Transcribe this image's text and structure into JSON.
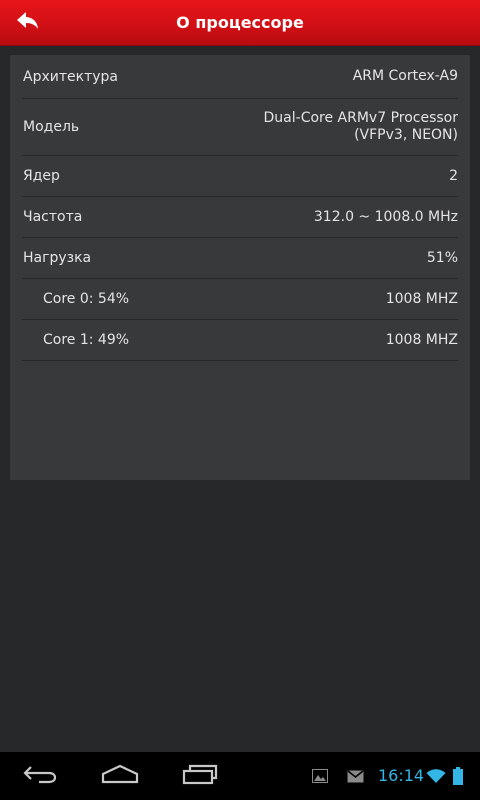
{
  "header": {
    "title": "О процессоре"
  },
  "cpu_info": {
    "rows": [
      {
        "label": "Архитектура",
        "value": "ARM Cortex-A9"
      },
      {
        "label": "Модель",
        "value_line1": "Dual-Core ARMv7 Processor",
        "value_line2": "(VFPv3, NEON)"
      },
      {
        "label": "Ядер",
        "value": "2"
      },
      {
        "label": "Частота",
        "value": "312.0 ~ 1008.0 MHz"
      },
      {
        "label": "Нагрузка",
        "value": "51%"
      },
      {
        "label": "Core 0: 54%",
        "value": "1008 MHZ"
      },
      {
        "label": "Core 1: 49%",
        "value": "1008 MHZ"
      }
    ]
  },
  "status_bar": {
    "time": "16:14",
    "icons": [
      "gallery-notification-icon",
      "gmail-notification-icon",
      "wifi-icon",
      "battery-icon"
    ]
  },
  "navigation": {
    "buttons": [
      "back-icon",
      "home-icon",
      "recent-apps-icon"
    ]
  },
  "colors": {
    "header": "#d11015",
    "background": "#27282a",
    "panel": "#38393b",
    "clock": "#33b5e5"
  }
}
